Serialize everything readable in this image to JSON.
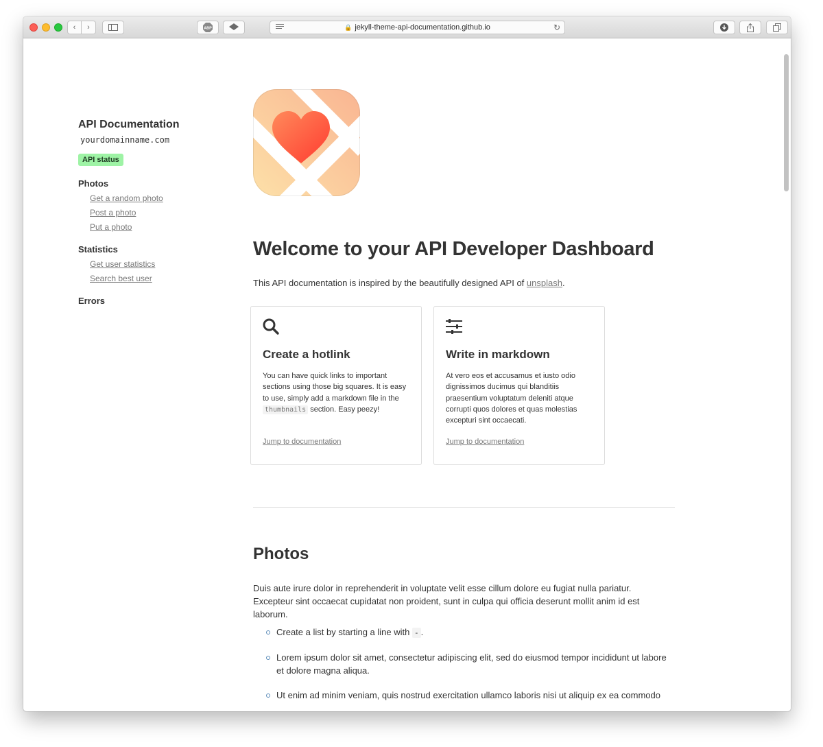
{
  "browser": {
    "url": "jekyll-theme-api-documentation.github.io",
    "adblock_label": "ABP"
  },
  "sidebar": {
    "title": "API Documentation",
    "domain": "yourdomainname.com",
    "status_badge": "API status",
    "sections": [
      {
        "title": "Photos",
        "links": [
          "Get a random photo",
          "Post a photo",
          "Put a photo"
        ]
      },
      {
        "title": "Statistics",
        "links": [
          "Get user statistics",
          "Search best user"
        ]
      },
      {
        "title": "Errors",
        "links": []
      }
    ]
  },
  "main": {
    "heading": "Welcome to your API Developer Dashboard",
    "intro_text": "This API documentation is inspired by the beautifully designed API of ",
    "intro_link": "unsplash",
    "intro_end": ".",
    "cards": [
      {
        "icon": "search-icon",
        "title": "Create a hotlink",
        "text_before": "You can have quick links to important sections using those big squares. It is easy to use, simply add a markdown file in the ",
        "code": "thumbnails",
        "text_after": " section. Easy peezy!",
        "link": "Jump to documentation"
      },
      {
        "icon": "sliders-icon",
        "title": "Write in markdown",
        "text": "At vero eos et accusamus et iusto odio dignissimos ducimus qui blanditiis praesentium voluptatum deleniti atque corrupti quos dolores et quas molestias excepturi sint occaecati.",
        "link": "Jump to documentation"
      }
    ],
    "photos_section": {
      "title": "Photos",
      "text": "Duis aute irure dolor in reprehenderit in voluptate velit esse cillum dolore eu fugiat nulla pariatur. Excepteur sint occaecat cupidatat non proident, sunt in culpa qui officia deserunt mollit anim id est laborum.",
      "bullets": [
        {
          "before": "Create a list by starting a line with ",
          "code": "-",
          "after": "."
        },
        {
          "before": "Lorem ipsum dolor sit amet, consectetur adipiscing elit, sed do eiusmod tempor incididunt ut labore et dolore magna aliqua.",
          "code": "",
          "after": ""
        },
        {
          "before": "Ut enim ad minim veniam, quis nostrud exercitation ullamco laboris nisi ut aliquip ex ea commodo",
          "code": "",
          "after": ""
        }
      ]
    }
  },
  "colors": {
    "badge_bg": "#9ef3a5",
    "link": "#777777",
    "heart_top": "#ff8a5b",
    "heart_bottom": "#ff3b30",
    "logo_peach": "#fbc49b"
  }
}
